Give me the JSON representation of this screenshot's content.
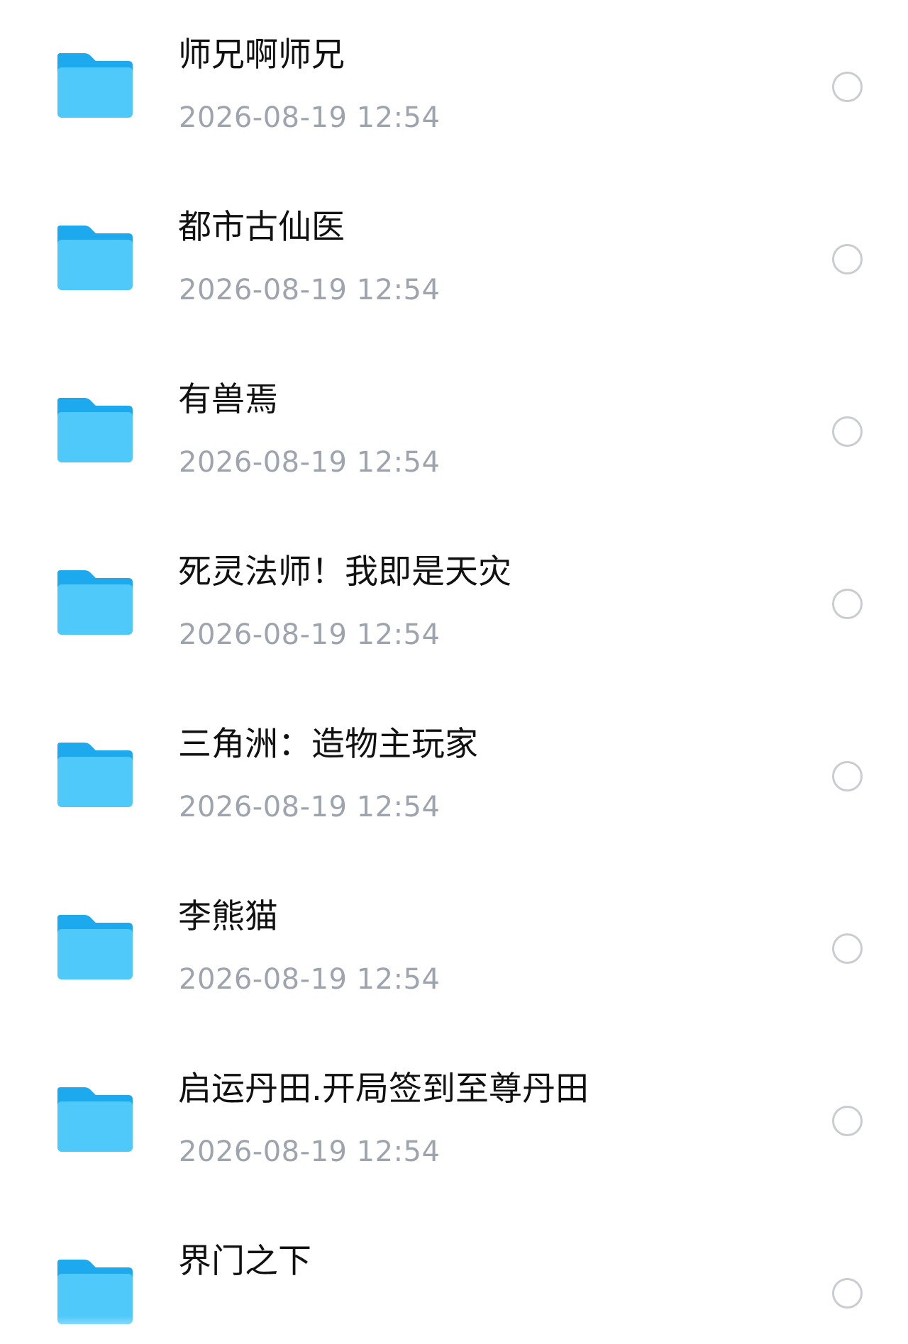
{
  "colors": {
    "folder_front": "#4FC8FA",
    "folder_back": "#1DA9EE",
    "name_text": "#111111",
    "date_text": "#9EA4AE",
    "radio_border": "#C9CCD1"
  },
  "icons": {
    "folder": "folder-icon",
    "select": "radio-unchecked-icon"
  },
  "files": [
    {
      "name": "师兄啊师兄",
      "date": "2026-08-19 12:54"
    },
    {
      "name": "都市古仙医",
      "date": "2026-08-19 12:54"
    },
    {
      "name": "有兽焉",
      "date": "2026-08-19 12:54"
    },
    {
      "name": "死灵法师！我即是天灾",
      "date": "2026-08-19 12:54"
    },
    {
      "name": "三角洲：造物主玩家",
      "date": "2026-08-19 12:54"
    },
    {
      "name": "李熊猫",
      "date": "2026-08-19 12:54"
    },
    {
      "name": "启运丹田.开局签到至尊丹田",
      "date": "2026-08-19 12:54"
    },
    {
      "name": "界门之下",
      "date": ""
    }
  ]
}
